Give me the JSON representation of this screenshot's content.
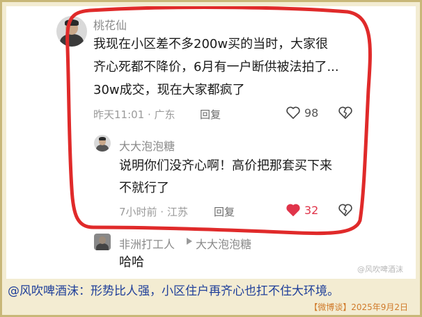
{
  "comment": {
    "username": "桃花仙",
    "lines": [
      "我现在小区差不多200w买的当时，大家很",
      "齐心死都不降价，6月有一户断供被法拍了...",
      "30w成交，现在大家都疯了"
    ],
    "time_location": "昨天11:01 · 广东",
    "reply_label": "回复",
    "likes": "98"
  },
  "reply1": {
    "username": "大大泡泡糖",
    "lines": [
      "说明你们没齐心啊！高价把那套买下来",
      "不就行了"
    ],
    "time_location": "7小时前 · 江苏",
    "reply_label": "回复",
    "likes": "32"
  },
  "reply2": {
    "username": "非洲打工人",
    "reply_to": "大大泡泡糖",
    "text": "哈哈"
  },
  "watermark": "@风吹啤酒沫",
  "caption": "@风吹啤酒沫：形势比人强，小区住户再齐心也扛不住大环境。",
  "source": "【微博谈】2025年9月2日",
  "colors": {
    "like_active": "#e0344a",
    "highlight_loop": "#e02a2a",
    "caption_text": "#1f3f9a",
    "source_text": "#d07a2a"
  },
  "icons": [
    "heart-icon",
    "dislike-heart-icon",
    "heart-filled-icon",
    "play-triangle-icon"
  ]
}
